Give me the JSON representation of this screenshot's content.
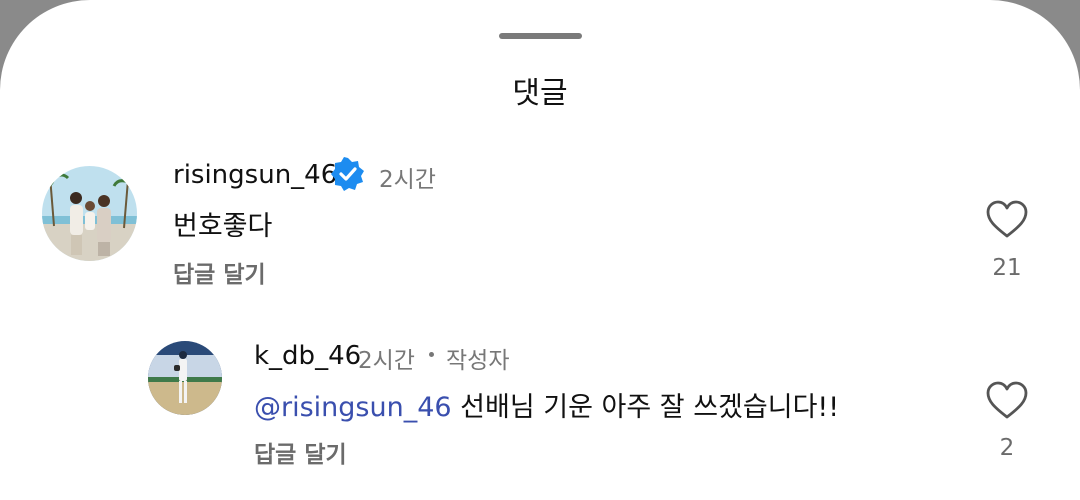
{
  "sheet": {
    "title": "댓글"
  },
  "comments": [
    {
      "username": "risingsun_46",
      "verified": true,
      "time": "2시간",
      "text": "번호좋다",
      "reply_label": "답글 달기",
      "likes": "21",
      "avatar_icon": "avatar-photo-family-beach"
    }
  ],
  "replies": [
    {
      "username": "k_db_46",
      "time": "2시간",
      "separator": "•",
      "author_tag": "작성자",
      "mention": "@risingsun_46",
      "text": " 선배님 기운 아주 잘 쓰겠습니다!!",
      "reply_label": "답글 달기",
      "likes": "2",
      "avatar_icon": "avatar-photo-baseball-player"
    }
  ],
  "colors": {
    "verified_badge": "#1d8cf0",
    "mention": "#3a4fae",
    "muted": "#777777"
  }
}
